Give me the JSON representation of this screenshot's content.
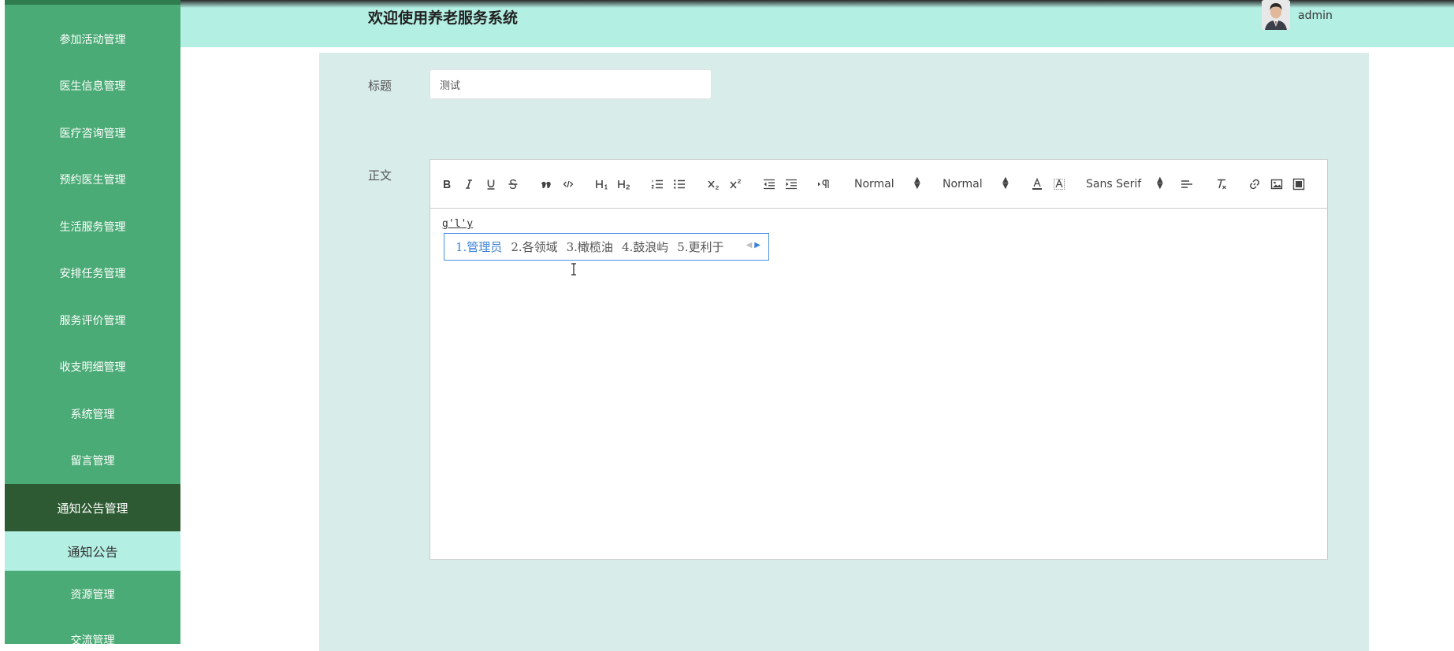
{
  "header": {
    "title": "欢迎使用养老服务系统",
    "username": "admin"
  },
  "sidebar": {
    "items": [
      {
        "label": "参加活动管理"
      },
      {
        "label": "医生信息管理"
      },
      {
        "label": "医疗咨询管理"
      },
      {
        "label": "预约医生管理"
      },
      {
        "label": "生活服务管理"
      },
      {
        "label": "安排任务管理"
      },
      {
        "label": "服务评价管理"
      },
      {
        "label": "收支明细管理"
      },
      {
        "label": "系统管理"
      },
      {
        "label": "留言管理"
      },
      {
        "label": "通知公告管理",
        "active": true
      },
      {
        "label": "通知公告",
        "sub": true
      },
      {
        "label": "资源管理"
      },
      {
        "label": "交流管理"
      }
    ]
  },
  "form": {
    "title_label": "标题",
    "title_value": "测试",
    "content_label": "正文",
    "content_text": "g'l'y"
  },
  "toolbar": {
    "header_picker": "Normal",
    "size_picker": "Normal",
    "font_picker": "Sans Serif",
    "buttons": [
      "bold-icon",
      "italic-icon",
      "underline-icon",
      "strike-icon",
      "blockquote-icon",
      "code-block-icon",
      "h1-icon",
      "h2-icon",
      "ordered-list-icon",
      "bullet-list-icon",
      "subscript-icon",
      "superscript-icon",
      "outdent-icon",
      "indent-icon",
      "rtl-direction-icon",
      "text-color-icon",
      "background-color-icon",
      "align-icon",
      "clean-format-icon",
      "link-icon",
      "image-icon",
      "video-icon"
    ]
  },
  "ime": {
    "candidates": [
      "1.管理员",
      "2.各领域",
      "3.橄榄油",
      "4.鼓浪屿",
      "5.更利于"
    ]
  },
  "colors": {
    "sidebar": "#4bab76",
    "sidebar_active": "#2d5a32",
    "sidebar_sub": "#b3efe3",
    "header": "#b3efe3",
    "panel": "#d8ecea",
    "ime_highlight": "#3b82d6"
  }
}
